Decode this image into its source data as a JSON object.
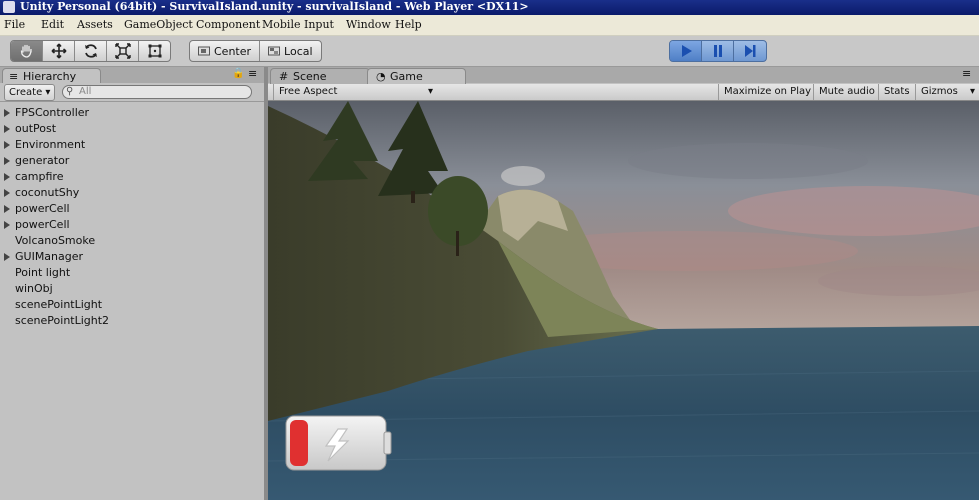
{
  "window": {
    "title": "Unity Personal (64bit) - SurvivalIsland.unity - survivalIsland - Web Player <DX11>"
  },
  "menu": {
    "items": [
      "File",
      "Edit",
      "Assets",
      "GameObject",
      "Component",
      "Mobile Input",
      "Window",
      "Help"
    ]
  },
  "toolbar": {
    "pivot_label": "Center",
    "space_label": "Local"
  },
  "hierarchy": {
    "tab_label": "Hierarchy",
    "create_label": "Create",
    "search_placeholder": "All",
    "items": [
      {
        "label": "FPSController",
        "expandable": true
      },
      {
        "label": "outPost",
        "expandable": true
      },
      {
        "label": "Environment",
        "expandable": true
      },
      {
        "label": "generator",
        "expandable": true
      },
      {
        "label": "campfire",
        "expandable": true
      },
      {
        "label": "coconutShy",
        "expandable": true
      },
      {
        "label": "powerCell",
        "expandable": true
      },
      {
        "label": "powerCell",
        "expandable": true
      },
      {
        "label": "VolcanoSmoke",
        "expandable": false
      },
      {
        "label": "GUIManager",
        "expandable": true
      },
      {
        "label": "Point light",
        "expandable": false
      },
      {
        "label": "winObj",
        "expandable": false
      },
      {
        "label": "scenePointLight",
        "expandable": false
      },
      {
        "label": "scenePointLight2",
        "expandable": false
      }
    ]
  },
  "tabs": {
    "scene_label": "Scene",
    "game_label": "Game"
  },
  "game": {
    "aspect_label": "Free Aspect",
    "maximize_label": "Maximize on Play",
    "mute_label": "Mute audio",
    "stats_label": "Stats",
    "gizmos_label": "Gizmos",
    "battery_charge": 0.2
  },
  "colors": {
    "play_active": "#3a78d0",
    "battery_red": "#e03030"
  }
}
